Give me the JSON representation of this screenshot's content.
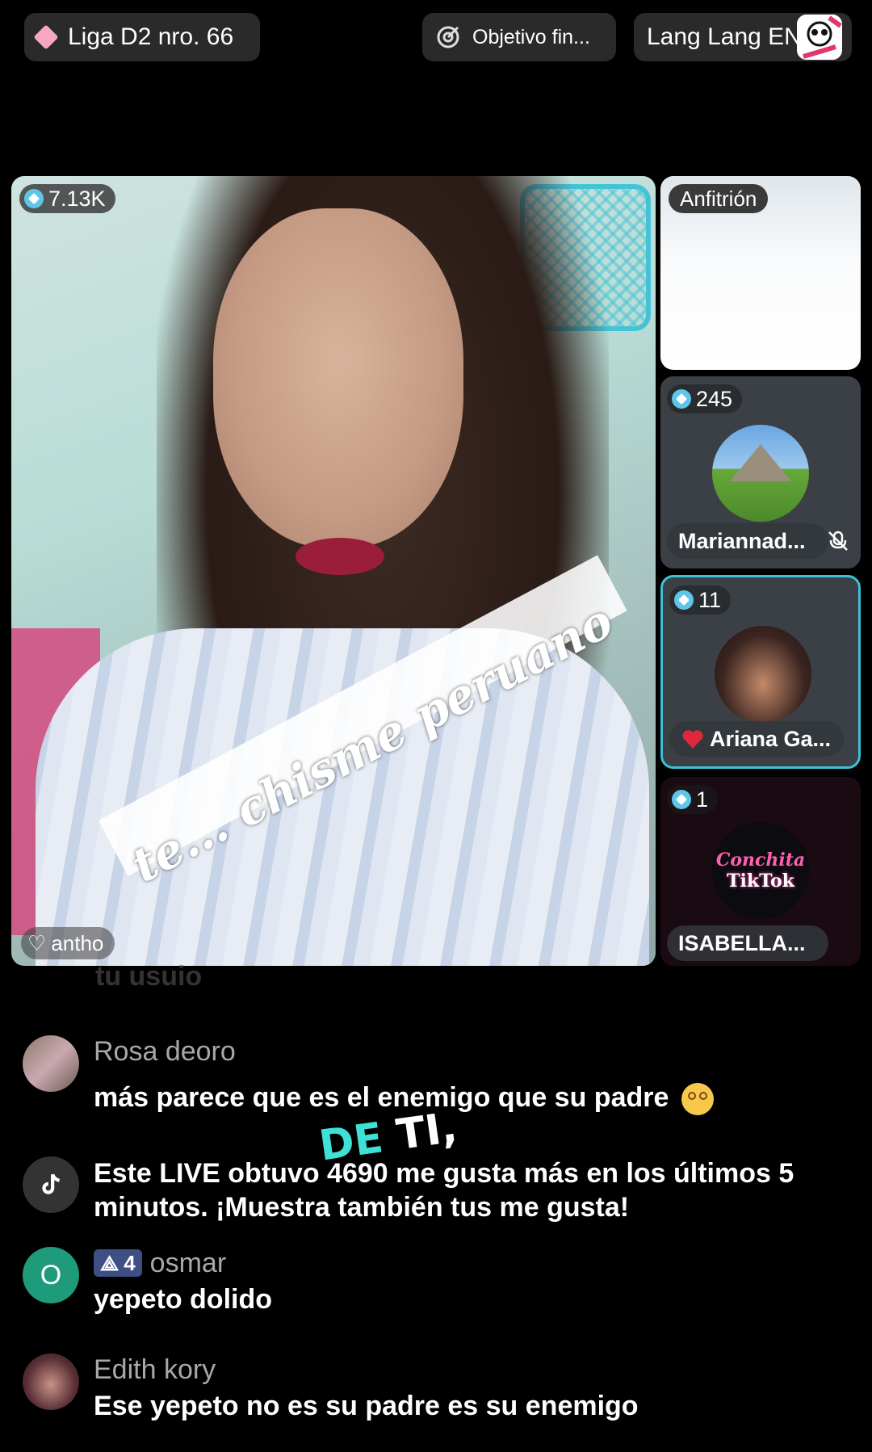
{
  "top_bar": {
    "league_label": "Liga D2 nro. 66",
    "goal_label": "Objetivo fin...",
    "lang_label": "Lang Lang EN"
  },
  "main_video": {
    "viewers": "7.13K",
    "name_tag": "antho"
  },
  "overlay": {
    "sticker_text": "te... chisme peruano",
    "caption_de": "DE",
    "caption_ti": "TI,"
  },
  "side_tiles": [
    {
      "label": "Anfitrión"
    },
    {
      "count": "245",
      "name": "Mariannad...",
      "muted": true
    },
    {
      "count": "11",
      "name": "Ariana Ga...",
      "highlight_color": "#3bc0d6"
    },
    {
      "count": "1",
      "name": "ISABELLA...",
      "logo_line1": "Conchita",
      "logo_line2": "TikTok"
    }
  ],
  "comments": [
    {
      "user": "Rosa deoro",
      "text": "más parece que es el enemigo que su padre"
    },
    {
      "user": "",
      "text": "Este LIVE obtuvo 4690 me gusta más en los últimos 5 minutos. ¡Muestra también tus me gusta!"
    },
    {
      "user": "osmar",
      "level": "4",
      "avatar_letter": "O",
      "text": "yepeto dolido"
    },
    {
      "user": "Edith kory",
      "text": "Ese yepeto no es su padre es su enemigo"
    }
  ],
  "faded_text": "tu usuio",
  "colors": {
    "accent_teal": "#3bc0d6",
    "level_badge": "#3e4f86",
    "osmar_avatar": "#1e9b7a"
  }
}
